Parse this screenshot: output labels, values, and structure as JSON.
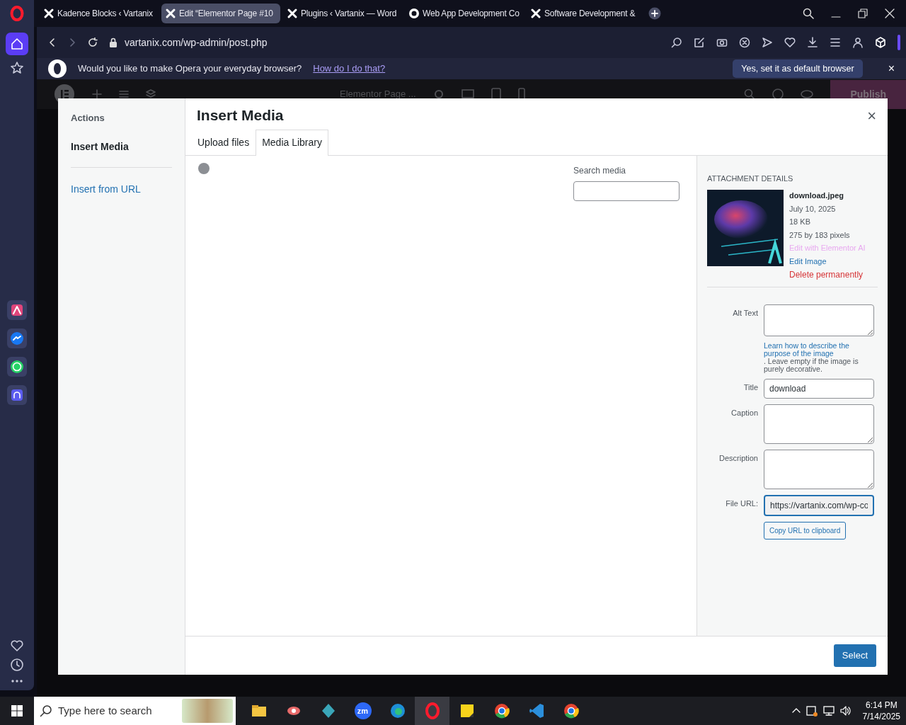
{
  "browser_tabs": [
    {
      "label": "Kadence Blocks ‹ Vartanix",
      "selected": false
    },
    {
      "label": "Edit “Elementor Page #10",
      "selected": true
    },
    {
      "label": "Plugins ‹ Vartanix — Word",
      "selected": false
    },
    {
      "label": "Web App Development Co",
      "selected": false
    },
    {
      "label": "Software Development &",
      "selected": false
    }
  ],
  "address": "vartanix.com/wp-admin/post.php",
  "banner": {
    "message": "Would you like to make Opera your everyday browser?",
    "link": "How do I do that?",
    "button": "Yes, set it as default browser",
    "close": "×"
  },
  "editor_toolbar": {
    "page_title": "Elementor Page ...",
    "publish": "Publish"
  },
  "modal": {
    "actions_heading": "Actions",
    "menu": [
      {
        "label": "Insert Media",
        "selected": true
      },
      {
        "label": "Insert from URL",
        "selected": false
      }
    ],
    "title": "Insert Media",
    "close": "×",
    "tabs": [
      {
        "label": "Upload files",
        "selected": false
      },
      {
        "label": "Media Library",
        "selected": true
      }
    ],
    "search_label": "Search media",
    "details": {
      "heading": "ATTACHMENT DETAILS",
      "filename": "download.jpeg",
      "date": "July 10, 2025",
      "size": "18 KB",
      "dimensions": "275 by 183 pixels",
      "actions": [
        {
          "label": "Edit with Elementor AI",
          "kind": "link",
          "disabled": true
        },
        {
          "label": "Edit Image",
          "kind": "link",
          "disabled": false
        },
        {
          "label": "Delete permanently",
          "kind": "delete",
          "disabled": false
        }
      ],
      "fields": [
        {
          "label": "Alt Text",
          "kind": "textarea",
          "help_link": "Learn how to describe the purpose of the image",
          "help_text": ". Leave empty if the image is purely decorative."
        },
        {
          "label": "Title",
          "kind": "input",
          "value": "download"
        },
        {
          "label": "Caption",
          "kind": "textarea"
        },
        {
          "label": "Description",
          "kind": "textarea"
        },
        {
          "label": "File URL:",
          "kind": "url",
          "value": "https://vartanix.com/wp-co"
        }
      ],
      "copy_button": "Copy URL to clipboard"
    },
    "select_button": "Select"
  },
  "taskbar": {
    "search_placeholder": "Type here to search",
    "zoom_label": "zm",
    "time": "6:14 PM",
    "date": "7/14/2025"
  }
}
